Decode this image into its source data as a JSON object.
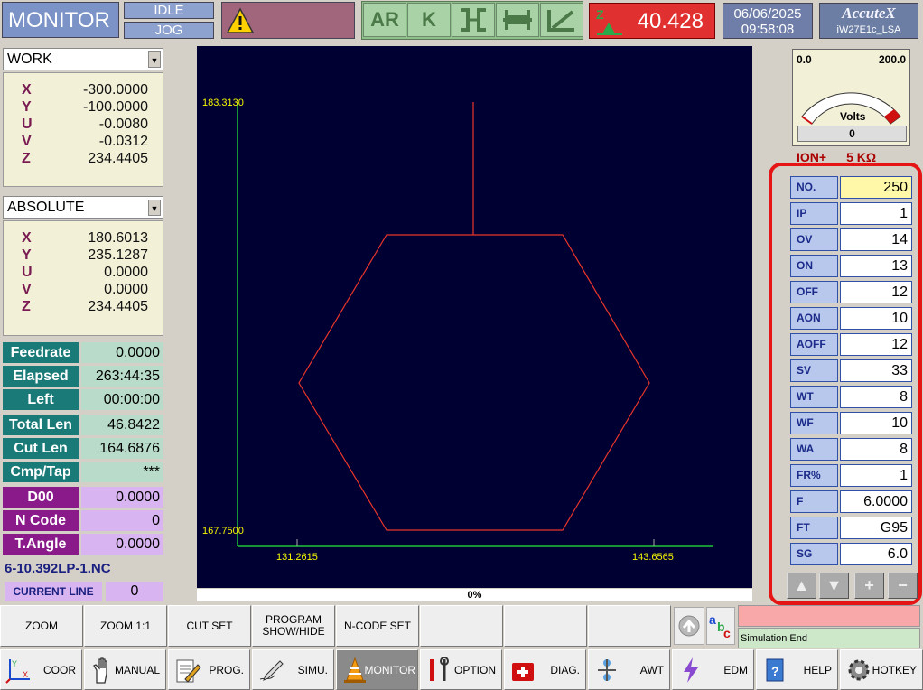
{
  "header": {
    "mode": "MONITOR",
    "state_top": "IDLE",
    "state_bottom": "JOG",
    "toolbar": [
      "AR",
      "K"
    ],
    "spark_value": "40.428",
    "date": "06/06/2025",
    "time": "09:58:08",
    "brand": "AccuteX",
    "model": "iW27E1c_LSA"
  },
  "work": {
    "label": "WORK",
    "X": "-300.0000",
    "Y": "-100.0000",
    "U": "-0.0080",
    "V": "-0.0312",
    "Z": "234.4405"
  },
  "absolute": {
    "label": "ABSOLUTE",
    "X": "180.6013",
    "Y": "235.1287",
    "U": "0.0000",
    "V": "0.0000",
    "Z": "234.4405"
  },
  "status": {
    "feedrate_l": "Feedrate",
    "feedrate": "0.0000",
    "elapsed_l": "Elapsed",
    "elapsed": "263:44:35",
    "left_l": "Left",
    "left": "00:00:00",
    "total_l": "Total Len",
    "total": "46.8422",
    "cut_l": "Cut Len",
    "cut": "164.6876",
    "cmp_l": "Cmp/Tap",
    "cmp": "***",
    "d_l": "D00",
    "d": "0.0000",
    "n_l": "N Code",
    "n": "0",
    "t_l": "T.Angle",
    "t": "0.0000"
  },
  "program": {
    "file": "6-10.392LP-1.NC",
    "current_line_l": "CURRENT LINE",
    "current_line": "0"
  },
  "graph": {
    "y_top": "183.3130",
    "y_bottom": "167.7500",
    "x_left": "131.2615",
    "x_right": "143.6565",
    "progress": "0%"
  },
  "meter": {
    "min": "0.0",
    "max": "200.0",
    "unit": "Volts",
    "reading": "0",
    "ion": "ION+",
    "ko": "5 KΩ"
  },
  "params": [
    {
      "k": "NO.",
      "v": "250"
    },
    {
      "k": "IP",
      "v": "1"
    },
    {
      "k": "OV",
      "v": "14"
    },
    {
      "k": "ON",
      "v": "13"
    },
    {
      "k": "OFF",
      "v": "12"
    },
    {
      "k": "AON",
      "v": "10"
    },
    {
      "k": "AOFF",
      "v": "12"
    },
    {
      "k": "SV",
      "v": "33"
    },
    {
      "k": "WT",
      "v": "8"
    },
    {
      "k": "WF",
      "v": "10"
    },
    {
      "k": "WA",
      "v": "8"
    },
    {
      "k": "FR%",
      "v": "1"
    },
    {
      "k": "F",
      "v": "6.0000"
    },
    {
      "k": "FT",
      "v": "G95"
    },
    {
      "k": "SG",
      "v": "6.0"
    }
  ],
  "fkeys": [
    "ZOOM",
    "ZOOM 1:1",
    "CUT SET",
    "PROGRAM SHOW/HIDE",
    "N-CODE SET"
  ],
  "message": "Simulation End",
  "nav": [
    "COOR",
    "MANUAL",
    "PROG.",
    "SIMU.",
    "MONITOR",
    "OPTION",
    "DIAG.",
    "AWT",
    "EDM",
    "HELP",
    "HOTKEY"
  ],
  "colors": {
    "accent": "#e61515",
    "graph_bg": "#000033",
    "path": "#e8352a",
    "axis": "#21c43a"
  }
}
